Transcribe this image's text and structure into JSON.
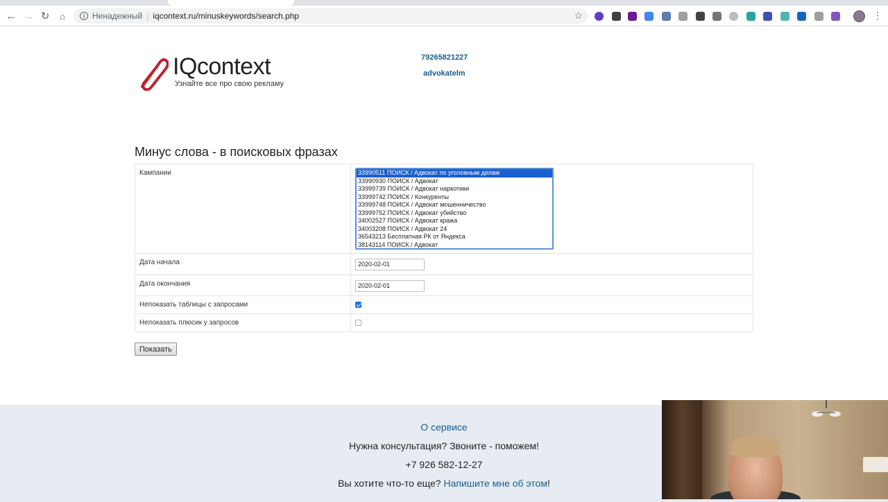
{
  "browser": {
    "security_label": "Ненадежный",
    "url": "iqcontext.ru/minuskeywords/search.php"
  },
  "header": {
    "logo_text": "IQcontext",
    "logo_tagline": "Узнайте все про свою рекламу",
    "user_phone": "79265821227",
    "user_login": "advokatelm"
  },
  "main": {
    "title": "Минус слова - в поисковых фразах",
    "campaigns_label": "Кампании",
    "campaigns": [
      "33990511 ПОИСК / Адвокат по уголовным делам",
      "33990930 ПОИСК / Адвокат",
      "33999739 ПОИСК / Адвокат наркотики",
      "33999742 ПОИСК / Конкуренты",
      "33999748 ПОИСК / Адвокат мошенничество",
      "33999752 ПОИСК / Адвокат убийство",
      "34002527 ПОИСК / Адвокат кража",
      "34003208 ПОИСК / Адвокат 24",
      "36543213 Бесплатная РК от Яндекса",
      "38143114 ПОИСК / Адвокат"
    ],
    "selected_campaign": "33990511 ПОИСК / Адвокат по уголовным делам",
    "date_start_label": "Дата начала",
    "date_start_value": "2020-02-01",
    "date_end_label": "Дата окончания",
    "date_end_value": "2020-02-01",
    "hide_tables_label": "Непоказать таблицы с запросами",
    "hide_tables_checked": true,
    "hide_plus_label": "Непоказать плюсик у запросов",
    "hide_plus_checked": false,
    "show_button": "Показать"
  },
  "footer": {
    "about_link": "О сервисе",
    "consult_text": "Нужна консультация? Звоните - поможем!",
    "phone": "+7 926 582-12-27",
    "want_text": "Вы хотите что-то еще? ",
    "write_link": "Напишите мне об этом",
    "want_suffix": "!"
  },
  "colors": {
    "link": "#1a5c8f",
    "selection": "#1a5fd0",
    "footer_bg": "#e6ecf1",
    "logo_clip": "#c0232c"
  }
}
